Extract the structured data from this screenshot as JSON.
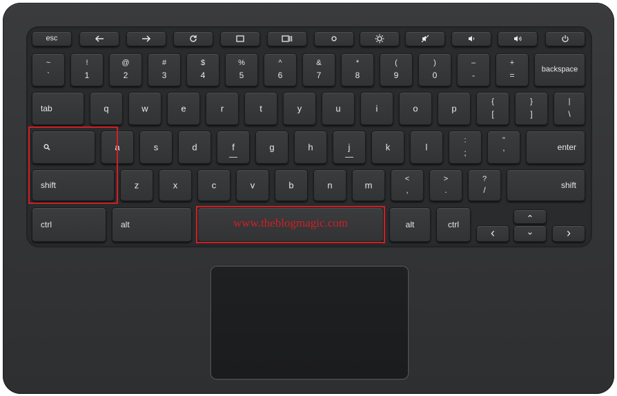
{
  "function_row": {
    "esc": "esc",
    "back_icon": "arrow-left",
    "forward_icon": "arrow-right",
    "refresh_icon": "refresh",
    "fullscreen_icon": "fullscreen",
    "overview_icon": "overview",
    "bright_down_icon": "brightness-down",
    "bright_up_icon": "brightness-up",
    "mute_icon": "mute",
    "vol_down_icon": "volume-down",
    "vol_up_icon": "volume-up",
    "power_icon": "power"
  },
  "number_row": [
    {
      "top": "~",
      "bottom": "`"
    },
    {
      "top": "!",
      "bottom": "1"
    },
    {
      "top": "@",
      "bottom": "2"
    },
    {
      "top": "#",
      "bottom": "3"
    },
    {
      "top": "$",
      "bottom": "4"
    },
    {
      "top": "%",
      "bottom": "5"
    },
    {
      "top": "^",
      "bottom": "6"
    },
    {
      "top": "&",
      "bottom": "7"
    },
    {
      "top": "*",
      "bottom": "8"
    },
    {
      "top": "(",
      "bottom": "9"
    },
    {
      "top": ")",
      "bottom": "0"
    },
    {
      "top": "–",
      "bottom": "-"
    },
    {
      "top": "+",
      "bottom": "="
    }
  ],
  "backspace": "backspace",
  "tab": "tab",
  "top_row": [
    "q",
    "w",
    "e",
    "r",
    "t",
    "y",
    "u",
    "i",
    "o",
    "p"
  ],
  "brace_keys": [
    {
      "top": "{",
      "bottom": "["
    },
    {
      "top": "}",
      "bottom": "]"
    },
    {
      "top": "|",
      "bottom": "\\"
    }
  ],
  "home_row": [
    "a",
    "s",
    "d",
    "f",
    "g",
    "h",
    "j",
    "k",
    "l"
  ],
  "home_punct": [
    {
      "top": ":",
      "bottom": ";"
    },
    {
      "top": "\"",
      "bottom": "'"
    }
  ],
  "enter": "enter",
  "shift_left": "shift",
  "bottom_row": [
    "z",
    "x",
    "c",
    "v",
    "b",
    "n",
    "m"
  ],
  "bottom_punct": [
    {
      "top": "<",
      "bottom": ","
    },
    {
      "top": ">",
      "bottom": "."
    },
    {
      "top": "?",
      "bottom": "/"
    }
  ],
  "shift_right": "shift",
  "ctrl_left": "ctrl",
  "alt_left": "alt",
  "watermark": "www.theblogmagic.com",
  "alt_right": "alt",
  "ctrl_right": "ctrl",
  "arrow_left": "‹",
  "arrow_up": "⌃",
  "arrow_down": "⌄",
  "arrow_right": "›",
  "highlight_color": "#d01f25"
}
